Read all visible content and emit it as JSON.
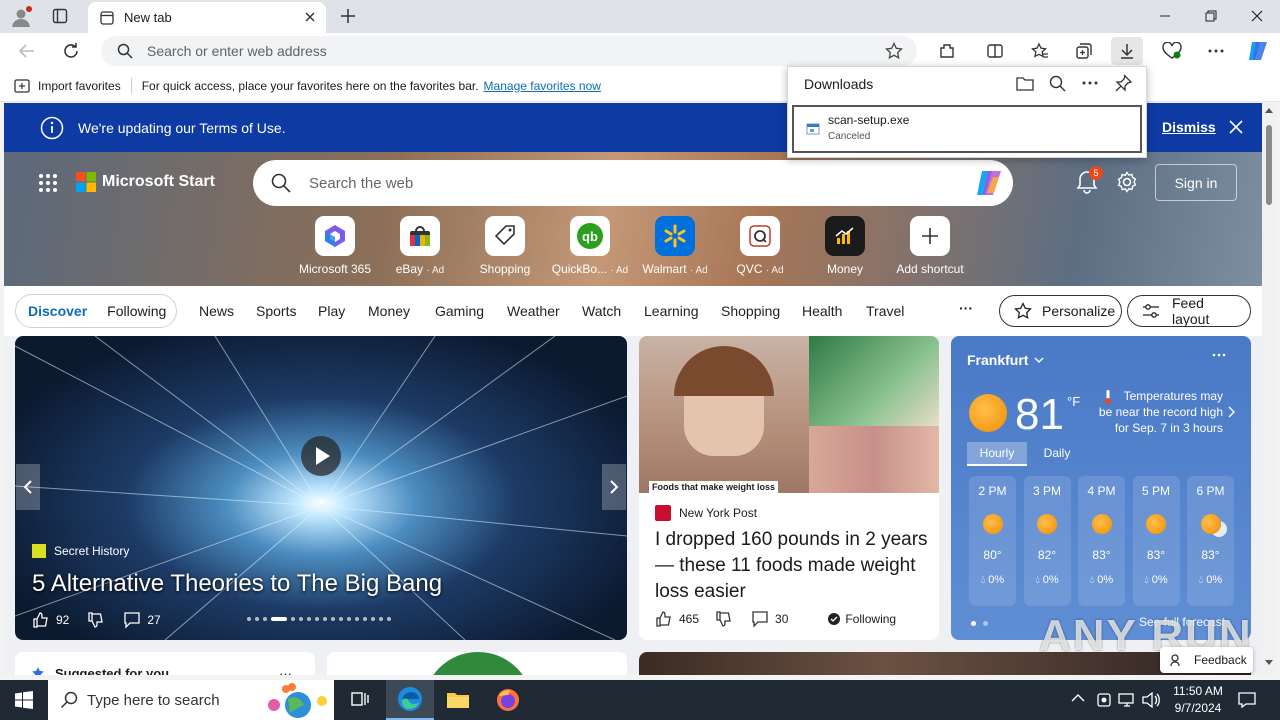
{
  "browser": {
    "tab_title": "New tab",
    "address_placeholder": "Search or enter web address"
  },
  "favorites_bar": {
    "import_label": "Import favorites",
    "hint": "For quick access, place your favorites here on the favorites bar.",
    "manage_link": "Manage favorites now"
  },
  "downloads": {
    "title": "Downloads",
    "file_name": "scan-setup.exe",
    "file_status": "Canceled"
  },
  "banner": {
    "text": "We're updating our Terms of Use.",
    "dismiss": "Dismiss"
  },
  "header": {
    "brand": "Microsoft Start",
    "search_placeholder": "Search the web",
    "notification_count": "5",
    "sign_in": "Sign in"
  },
  "shortcuts": [
    {
      "label": "Microsoft 365",
      "ad": ""
    },
    {
      "label": "eBay",
      "ad": "· Ad"
    },
    {
      "label": "Shopping",
      "ad": ""
    },
    {
      "label": "QuickBo...",
      "ad": "· Ad"
    },
    {
      "label": "Walmart",
      "ad": "· Ad"
    },
    {
      "label": "QVC",
      "ad": "· Ad"
    },
    {
      "label": "Money",
      "ad": ""
    },
    {
      "label": "Add shortcut",
      "ad": ""
    }
  ],
  "nav": {
    "discover": "Discover",
    "following": "Following",
    "items": [
      "News",
      "Sports",
      "Play",
      "Money",
      "Gaming",
      "Weather",
      "Watch",
      "Learning",
      "Shopping",
      "Health",
      "Travel"
    ],
    "more": "···",
    "personalize": "Personalize",
    "feed_layout": "Feed layout"
  },
  "hero_card": {
    "source": "Secret History",
    "title": "5 Alternative Theories to The Big Bang",
    "likes": "92",
    "comments": "27"
  },
  "news_card": {
    "image_caption": "Foods that make weight loss",
    "source": "New York Post",
    "title": "I dropped 160 pounds in 2 years — these 11 foods made weight loss easier",
    "likes": "465",
    "comments": "30",
    "following": "Following"
  },
  "weather": {
    "city": "Frankfurt",
    "temp": "81",
    "unit": "°F",
    "alert": "Temperatures may be near the record high for Sep. 7 in 3 hours",
    "tab_hourly": "Hourly",
    "tab_daily": "Daily",
    "hours": [
      {
        "time": "2 PM",
        "temp": "80°",
        "precip": "0%",
        "icon": "sun-icon"
      },
      {
        "time": "3 PM",
        "temp": "82°",
        "precip": "0%",
        "icon": "sun-icon"
      },
      {
        "time": "4 PM",
        "temp": "83°",
        "precip": "0%",
        "icon": "sun-icon"
      },
      {
        "time": "5 PM",
        "temp": "83°",
        "precip": "0%",
        "icon": "sun-icon"
      },
      {
        "time": "6 PM",
        "temp": "83°",
        "precip": "0%",
        "icon": "partly-cloudy-icon"
      }
    ],
    "see_full": "See full forecast"
  },
  "lower": {
    "suggested": "Suggested for you",
    "feedback": "Feedback",
    "watermark": "ANY RUN"
  },
  "taskbar": {
    "search_placeholder": "Type here to search",
    "time": "11:50 AM",
    "date": "9/7/2024"
  }
}
